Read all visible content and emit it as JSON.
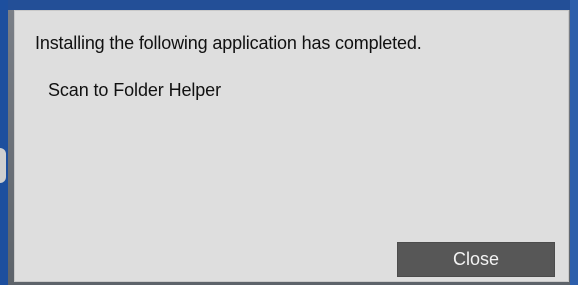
{
  "dialog": {
    "message": "Installing the following application has completed.",
    "application_name": "Scan to Folder Helper",
    "close_label": "Close"
  }
}
